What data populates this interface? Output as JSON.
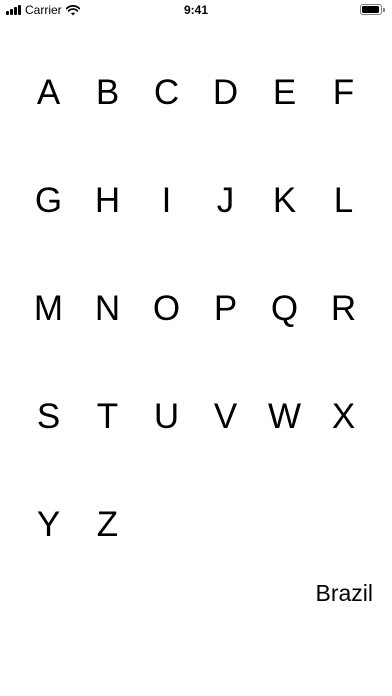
{
  "status_bar": {
    "carrier": "Carrier",
    "time": "9:41"
  },
  "letters": [
    "A",
    "B",
    "C",
    "D",
    "E",
    "F",
    "G",
    "H",
    "I",
    "J",
    "K",
    "L",
    "M",
    "N",
    "O",
    "P",
    "Q",
    "R",
    "S",
    "T",
    "U",
    "V",
    "W",
    "X",
    "Y",
    "Z"
  ],
  "country": "Brazil"
}
